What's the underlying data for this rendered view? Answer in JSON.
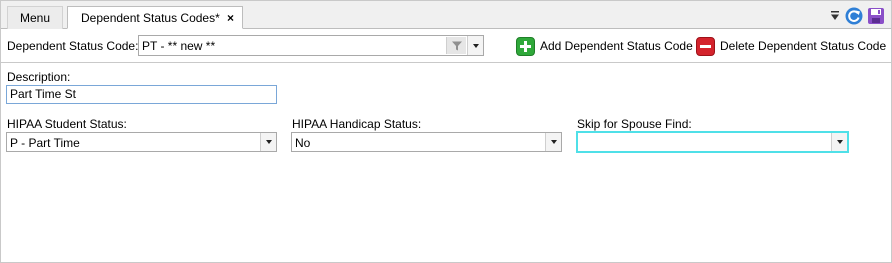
{
  "tabs": {
    "menu_label": "Menu",
    "active_label": "Dependent Status Codes*",
    "close_glyph": "×"
  },
  "toolbar": {
    "code_label": "Dependent Status Code:",
    "code_value": "PT - ** new **",
    "add_label": "Add Dependent Status Code",
    "delete_label": "Delete Dependent Status Code"
  },
  "form": {
    "description_label": "Description:",
    "description_value": "Part Time St",
    "hipaa_student_label": "HIPAA Student Status:",
    "hipaa_student_value": "P - Part Time",
    "hipaa_handicap_label": "HIPAA Handicap Status:",
    "hipaa_handicap_value": "No",
    "skip_spouse_label": "Skip for Spouse Find:",
    "skip_spouse_value": ""
  },
  "colors": {
    "accent_focus": "#4fe0e8",
    "add_green": "#2fa83a",
    "delete_red": "#d4232c"
  },
  "icons": [
    "filter-icon",
    "dropdown-icon",
    "refresh-icon",
    "save-icon",
    "add-icon",
    "delete-icon"
  ]
}
